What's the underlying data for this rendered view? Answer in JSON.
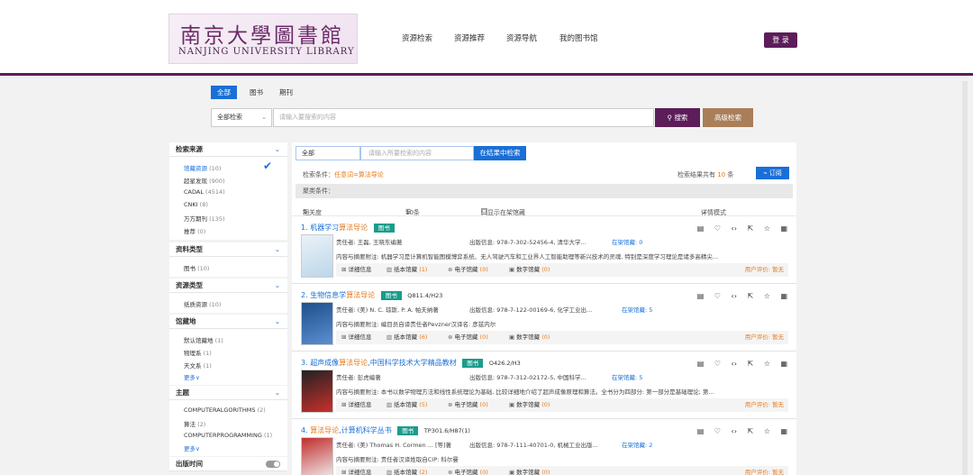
{
  "header": {
    "logo_cn": "南京大學圖書館",
    "logo_en": "NANJING UNIVERSITY LIBRARY",
    "nav": [
      "资源检索",
      "资源推荐",
      "资源导航",
      "我的图书馆"
    ],
    "login": "登 录"
  },
  "search": {
    "tabs": [
      "全部",
      "图书",
      "期刊"
    ],
    "scope": "全部检索",
    "placeholder": "请输入要搜索的内容",
    "search_label": "搜索",
    "advanced_label": "高级检索"
  },
  "sidebar": {
    "source": {
      "title": "检索来源",
      "items": [
        {
          "label": "馆藏资源",
          "count": "(10)"
        },
        {
          "label": "超星发现",
          "count": "(900)"
        },
        {
          "label": "CADAL",
          "count": "(4514)"
        },
        {
          "label": "CNKI",
          "count": "(8)"
        },
        {
          "label": "万方期刊",
          "count": "(135)"
        },
        {
          "label": "推荐",
          "count": "(0)"
        }
      ]
    },
    "type": {
      "title": "资料类型",
      "items": [
        {
          "label": "图书",
          "count": "(10)"
        }
      ]
    },
    "restype": {
      "title": "资源类型",
      "items": [
        {
          "label": "纸质资源",
          "count": "(10)"
        }
      ]
    },
    "location": {
      "title": "馆藏地",
      "items": [
        {
          "label": "默认馆藏地",
          "count": "(1)"
        },
        {
          "label": "物理系",
          "count": "(1)"
        },
        {
          "label": "天文系",
          "count": "(1)"
        }
      ],
      "more": "更多∨"
    },
    "subject": {
      "title": "主题",
      "items": [
        {
          "label": "COMPUTERALGORITHMS",
          "count": "(2)"
        },
        {
          "label": "算法",
          "count": "(2)"
        },
        {
          "label": "COMPUTERPROGRAMMING",
          "count": "(1)"
        }
      ],
      "more": "更多∨"
    },
    "pubdate": {
      "title": "出版时间"
    }
  },
  "main": {
    "within_scope": "全部",
    "within_placeholder": "请输入所要检索的内容",
    "within_button": "在结果中检索",
    "cond_label": "检索条件：",
    "cond_value": "任意词=算法导论",
    "total_prefix": "检索结果共有",
    "total_count": "10",
    "total_suffix": "条",
    "rss": "订阅",
    "facet_cond": "聚类条件：",
    "sort_label": "相关度",
    "page_size": "10条",
    "shelf_only": "只显示在架馆藏",
    "view_mode": "详情模式"
  },
  "records": [
    {
      "num": "1.",
      "t1": "机器学习",
      "hl": "算法导论",
      "t2": "",
      "type": "图书",
      "call": "",
      "author": "责任者: 王磊, 王晓东编著",
      "pub": "出版信息: 978-7-302-52456-4, 清华大学...",
      "hold": "在架馆藏: 0",
      "abstract": "内容与摘要附注: 机器学习是计算机智能图模博弈系统、无人驾驶汽车和工业界人工智能助理等新兴技术的灵魂, 特别是深度学习理论是诸多高精尖...",
      "detail": "详细信息",
      "paper": "纸本馆藏",
      "paper_n": "(1)",
      "ebook": "电子馆藏",
      "ebook_n": "(0)",
      "digital": "数字馆藏",
      "digital_n": "(0)",
      "rating": "用户评价: 暂无"
    },
    {
      "num": "2.",
      "t1": "生物信息学",
      "hl": "算法导论",
      "t2": "",
      "type": "图书",
      "call": "Q811.4/H23",
      "author": "责任者: (美) N. C. 琼斯, P. A. 帕夫纳著",
      "pub": "出版信息: 978-7-122-00169-6, 化学工业出...",
      "hold": "在架馆藏: 5",
      "abstract": "内容与摘要附注: 编目员自译责任者Pevzner汉译名: 彦兹内尔",
      "detail": "详细信息",
      "paper": "纸本馆藏",
      "paper_n": "(6)",
      "ebook": "电子馆藏",
      "ebook_n": "(0)",
      "digital": "数字馆藏",
      "digital_n": "(0)",
      "rating": "用户评价: 暂无"
    },
    {
      "num": "3.",
      "t1": "超声成像",
      "hl": "算法导论",
      "t2": ",中国科学技术大学精品教材",
      "type": "图书",
      "call": "O426.2/H3",
      "author": "责任者: 彭虎编著",
      "pub": "出版信息: 978-7-312-02172-5, 中国科学...",
      "hold": "在架馆藏: 5",
      "abstract": "内容与摘要附注: 本书以数学物理方法和线性系统理论为基础, 比较详细地介绍了超声成像原理和算法。全书分为四部分: 第一部分是基础理论; 第...",
      "detail": "详细信息",
      "paper": "纸本馆藏",
      "paper_n": "(5)",
      "ebook": "电子馆藏",
      "ebook_n": "(0)",
      "digital": "数字馆藏",
      "digital_n": "(0)",
      "rating": "用户评价: 暂无"
    },
    {
      "num": "4.",
      "t1": "",
      "hl": "算法导论",
      "t2": ",计算机科学丛书",
      "type": "图书",
      "call": "TP301.6/H87(1)",
      "author": "责任者: (美) Thomas H. Cormen ... [等]著",
      "pub": "出版信息: 978-7-111-40701-0, 机械工业出版...",
      "hold": "在架馆藏: 2",
      "abstract": "内容与摘要附注: 责任者汉译姓取自CIP: 科尔曼",
      "detail": "详细信息",
      "paper": "纸本馆藏",
      "paper_n": "(2)",
      "ebook": "电子馆藏",
      "ebook_n": "(0)",
      "digital": "数字馆藏",
      "digital_n": "(0)",
      "rating": "用户评价: 暂无"
    }
  ],
  "colors": {
    "brand": "#5c1d5a",
    "link": "#1a6fd6",
    "highlight": "#e77b1c",
    "badge": "#1a9c8c",
    "advanced": "#a97f5a"
  }
}
